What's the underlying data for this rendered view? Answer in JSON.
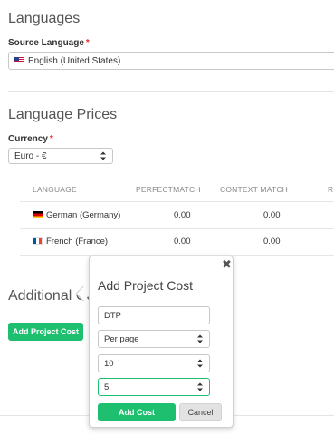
{
  "languages": {
    "title": "Languages",
    "source_label": "Source Language",
    "required_mark": "*",
    "source_value": "English (United States)"
  },
  "prices": {
    "title": "Language Prices",
    "currency_label": "Currency",
    "required_mark": "*",
    "currency_value": "Euro - €",
    "columns": [
      "LANGUAGE",
      "PERFECTMATCH",
      "CONTEXT MATCH",
      "RE"
    ],
    "rows": [
      {
        "language": "German (Germany)",
        "perfect": "0.00",
        "context": "0.00"
      },
      {
        "language": "French (France)",
        "perfect": "0.00",
        "context": "0.00"
      }
    ]
  },
  "additional": {
    "title": "Additional Cost",
    "add_button": "Add Project Cost"
  },
  "popover": {
    "title": "Add Project Cost",
    "close": "✖",
    "name_value": "DTP",
    "unit_value": "Per page",
    "quantity_value": "10",
    "price_value": "5",
    "submit_label": "Add Cost",
    "cancel_label": "Cancel"
  },
  "colors": {
    "accent": "#1ec070",
    "required": "#e03030"
  },
  "icons": {
    "us_flag": "flag-us-icon",
    "de_flag": "flag-de-icon",
    "fr_flag": "flag-fr-icon",
    "close": "close-icon",
    "updown": "updown-arrows-icon"
  }
}
